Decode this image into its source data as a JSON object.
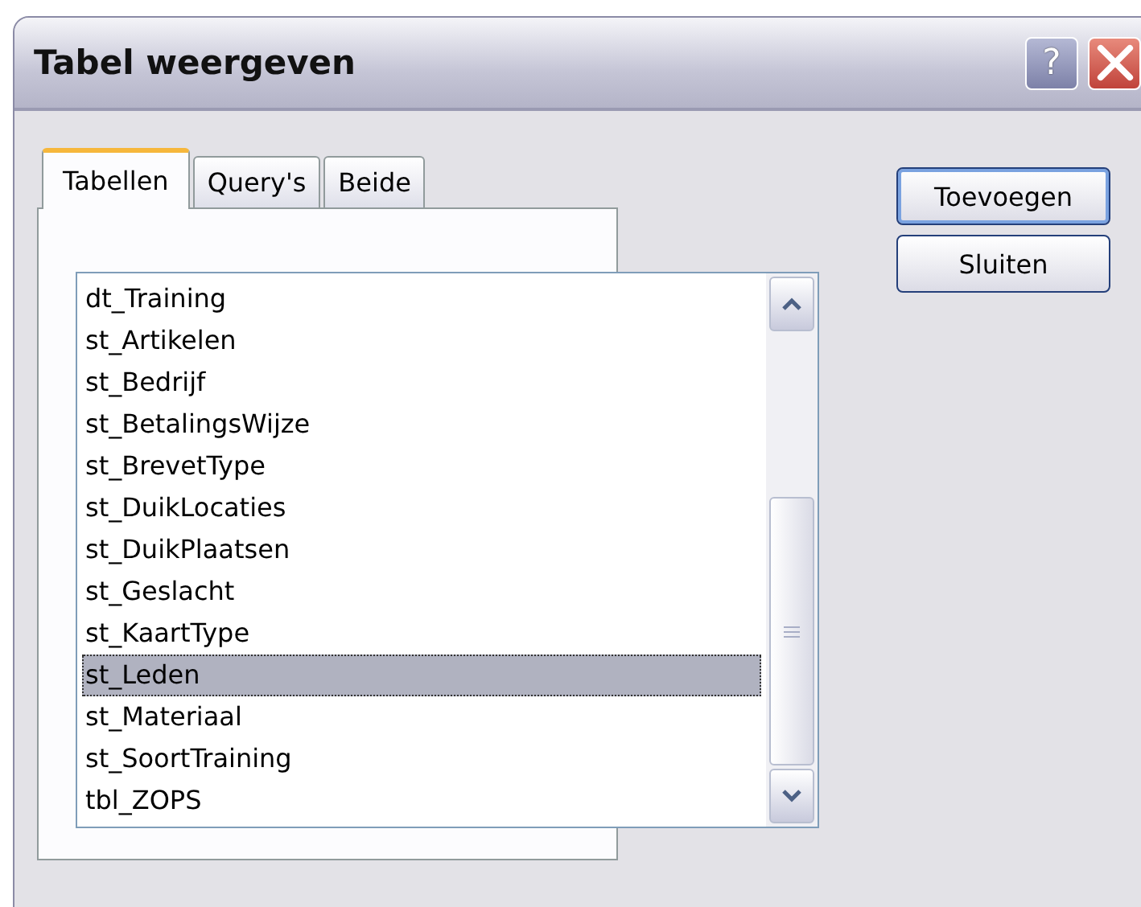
{
  "window": {
    "title": "Tabel weergeven",
    "help_button": "?"
  },
  "tabs": [
    {
      "label": "Tabellen",
      "selected": true
    },
    {
      "label": "Query's",
      "selected": false
    },
    {
      "label": "Beide",
      "selected": false
    }
  ],
  "list": {
    "items": [
      {
        "label": "dt_Training",
        "selected": false
      },
      {
        "label": "st_Artikelen",
        "selected": false
      },
      {
        "label": "st_Bedrijf",
        "selected": false
      },
      {
        "label": "st_BetalingsWijze",
        "selected": false
      },
      {
        "label": "st_BrevetType",
        "selected": false
      },
      {
        "label": "st_DuikLocaties",
        "selected": false
      },
      {
        "label": "st_DuikPlaatsen",
        "selected": false
      },
      {
        "label": "st_Geslacht",
        "selected": false
      },
      {
        "label": "st_KaartType",
        "selected": false
      },
      {
        "label": "st_Leden",
        "selected": true
      },
      {
        "label": "st_Materiaal",
        "selected": false
      },
      {
        "label": "st_SoortTraining",
        "selected": false
      },
      {
        "label": "tbl_ZOPS",
        "selected": false
      }
    ]
  },
  "buttons": [
    {
      "label": "Toevoegen",
      "default": true
    },
    {
      "label": "Sluiten",
      "default": false
    }
  ]
}
